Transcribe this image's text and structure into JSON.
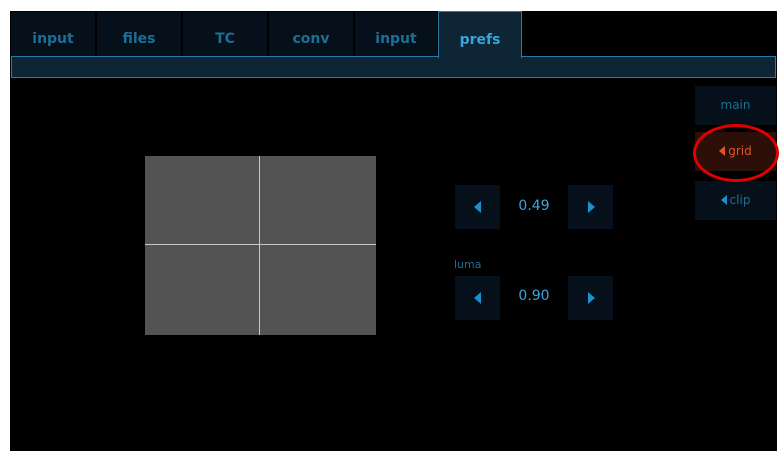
{
  "tabs": [
    {
      "label": "input",
      "active": false
    },
    {
      "label": "files",
      "active": false
    },
    {
      "label": "TC",
      "active": false
    },
    {
      "label": "conv",
      "active": false
    },
    {
      "label": "input",
      "active": false
    },
    {
      "label": "prefs",
      "active": true
    }
  ],
  "steppers": {
    "first": {
      "value": "0.49",
      "decrement_icon": "triangle-left",
      "increment_icon": "triangle-right"
    },
    "luma": {
      "label": "luma",
      "value": "0.90",
      "decrement_icon": "triangle-left",
      "increment_icon": "triangle-right"
    }
  },
  "side_menu": {
    "items": [
      {
        "label": "main",
        "icon": null,
        "selected": false
      },
      {
        "label": "grid",
        "icon": "triangle-left",
        "selected": true
      },
      {
        "label": "clip",
        "icon": "triangle-left",
        "selected": false
      }
    ]
  },
  "colors": {
    "background": "#000000",
    "tab_text": "#1b6f96",
    "tab_active_text": "#38a6d9",
    "accent_blue": "#1c8fd0",
    "selected_text": "#e0532a",
    "highlight_ring": "#e10000",
    "preview_fill": "#535353",
    "grid_line": "#c8c8c8"
  }
}
